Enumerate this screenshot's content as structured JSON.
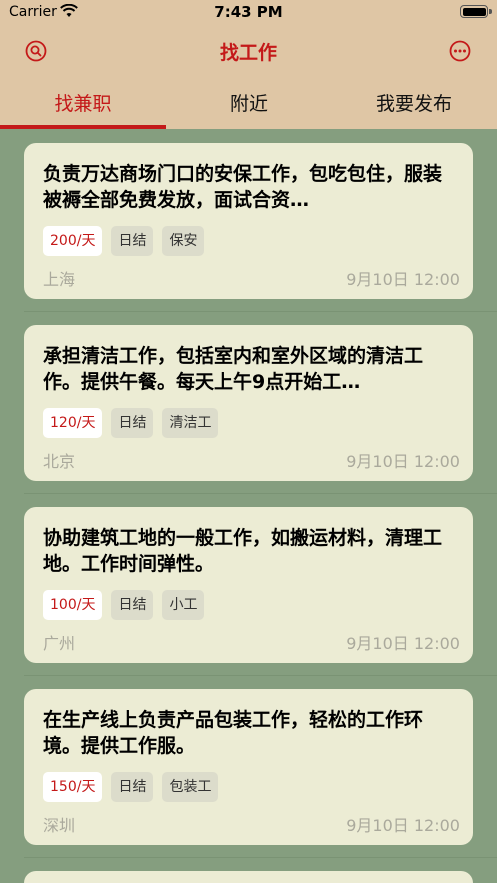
{
  "status_bar": {
    "carrier": "Carrier",
    "time": "7:43 PM"
  },
  "nav": {
    "title": "找工作",
    "left_icon": "search-icon",
    "right_icon": "more-icon"
  },
  "tabs": [
    {
      "label": "找兼职",
      "active": true
    },
    {
      "label": "附近",
      "active": false
    },
    {
      "label": "我要发布",
      "active": false
    }
  ],
  "jobs": [
    {
      "description": "负责万达商场门口的安保工作，包吃包住，服装被褥全部免费发放，面试合资…",
      "pay": "200/天",
      "settlement": "日结",
      "category": "保安",
      "location": "上海",
      "date": "9月10日 12:00"
    },
    {
      "description": "承担清洁工作，包括室内和室外区域的清洁工作。提供午餐。每天上午9点开始工…",
      "pay": "120/天",
      "settlement": "日结",
      "category": "清洁工",
      "location": "北京",
      "date": "9月10日 12:00"
    },
    {
      "description": "协助建筑工地的一般工作，如搬运材料，清理工地。工作时间弹性。",
      "pay": "100/天",
      "settlement": "日结",
      "category": "小工",
      "location": "广州",
      "date": "9月10日 12:00"
    },
    {
      "description": "在生产线上负责产品包装工作，轻松的工作环境。提供工作服。",
      "pay": "150/天",
      "settlement": "日结",
      "category": "包装工",
      "location": "深圳",
      "date": "9月10日 12:00"
    }
  ],
  "colors": {
    "accent": "#c41919",
    "header_bg": "#dfc6a5",
    "list_bg": "#859e7f",
    "card_bg": "#ececd4"
  }
}
